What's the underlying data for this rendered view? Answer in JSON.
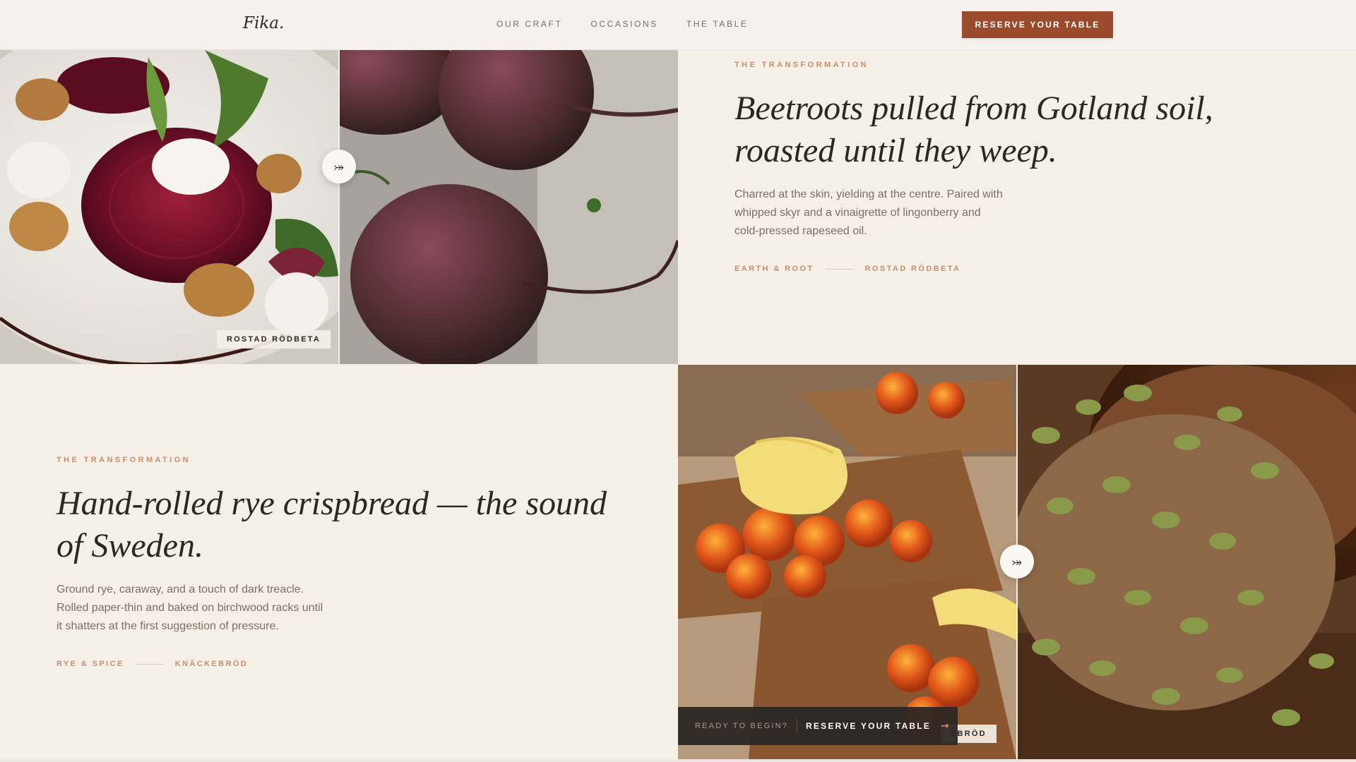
{
  "brand": {
    "logo": "Fika."
  },
  "nav": {
    "items": [
      {
        "label": "OUR CRAFT"
      },
      {
        "label": "OCCASIONS"
      },
      {
        "label": "THE TABLE"
      }
    ],
    "cta": "RESERVE YOUR TABLE"
  },
  "sections": [
    {
      "eyebrow": "THE TRANSFORMATION",
      "headline_line1": "Beetroots pulled from Gotland soil,",
      "headline_line2": "roasted until they weep.",
      "body_line1": "Charred at the skin, yielding at the centre. Paired with",
      "body_line2": "whipped skyr and a vinaigrette of lingonberry and",
      "body_line3": "cold-pressed rapeseed oil.",
      "tag_category": "EARTH & ROOT",
      "tag_dish": "ROSTAD RÖDBETA",
      "photo_label": "ROSTAD RÖDBETA",
      "swap_icon": "⤖"
    },
    {
      "eyebrow": "THE TRANSFORMATION",
      "headline_line1": "Hand-rolled rye crispbread — the sound",
      "headline_line2": "of Sweden.",
      "body_line1": "Ground rye, caraway, and a touch of dark treacle.",
      "body_line2": "Rolled paper-thin and baked on birchwood racks until",
      "body_line3": "it shatters at the first suggestion of pressure.",
      "tag_category": "RYE & SPICE",
      "tag_dish": "KNÄCKEBRÖD",
      "photo_label": "EBRÖD",
      "swap_icon": "⤖"
    }
  ],
  "sticky": {
    "ready": "READY TO BEGIN?",
    "cta": "RESERVE YOUR TABLE",
    "arrow": "→"
  }
}
